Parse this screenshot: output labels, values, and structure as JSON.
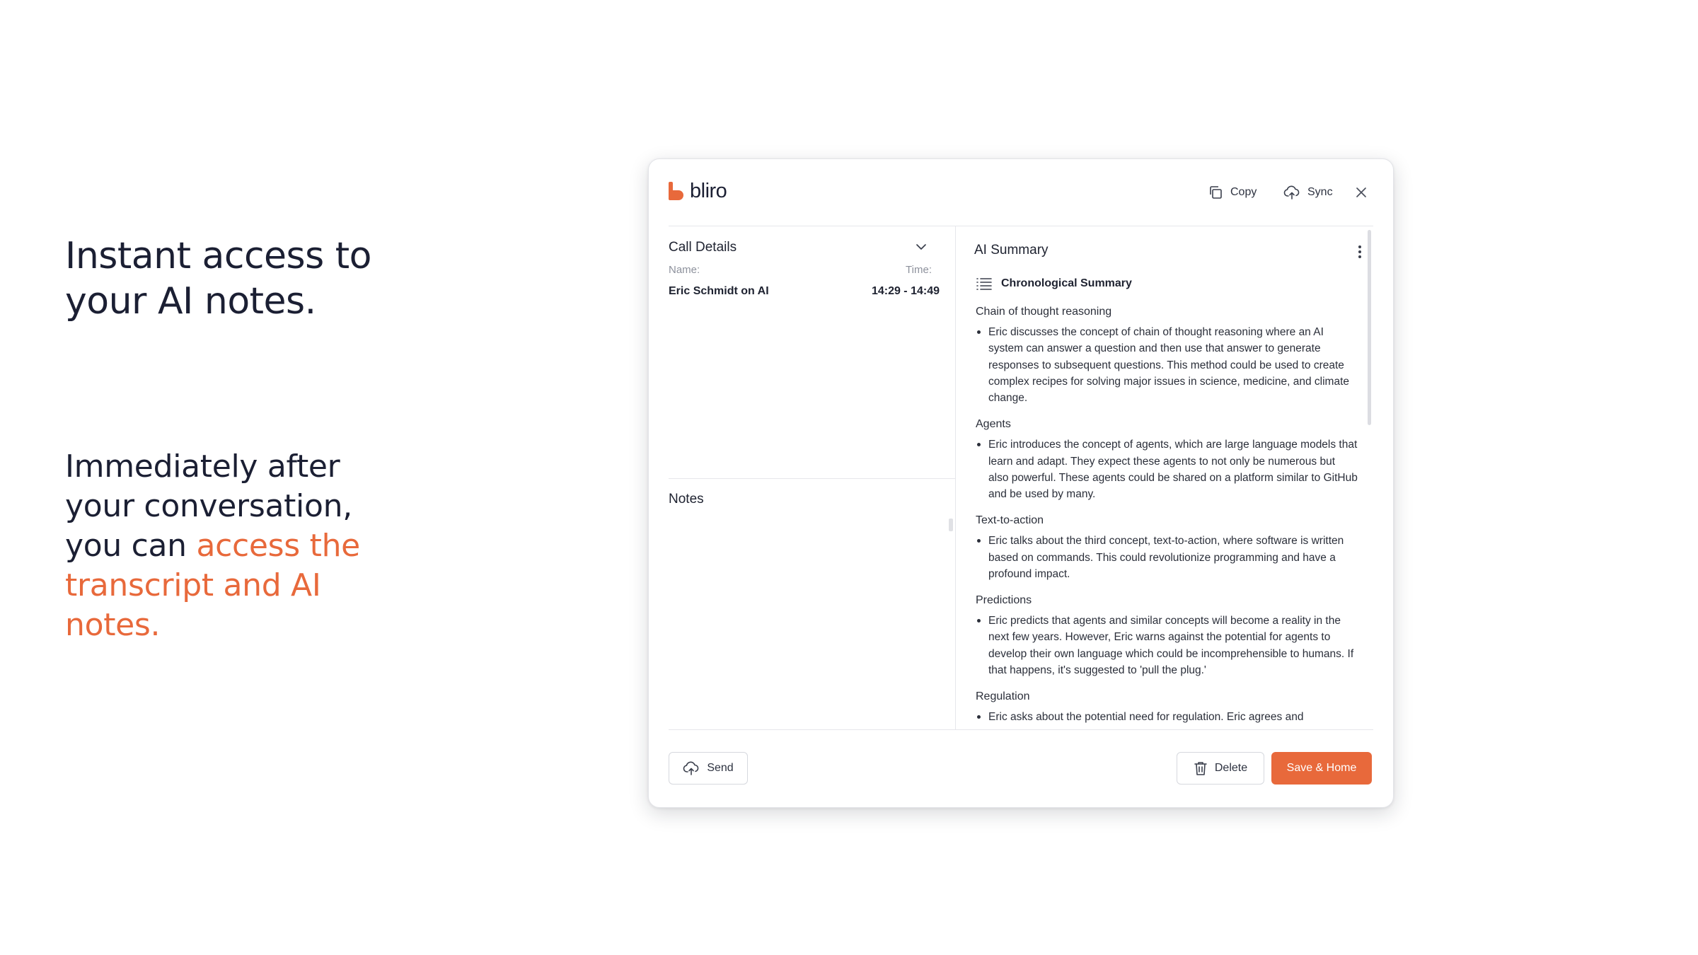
{
  "hero": {
    "title_line1": "Instant access to",
    "title_line2": "your AI notes.",
    "body_line1": "Immediately after",
    "body_line2": "your conversation,",
    "body_line3_plain": "you can ",
    "body_line3_accent": "access the",
    "body_line4_accent": "transcript and AI",
    "body_line5_accent": "notes."
  },
  "app": {
    "logo_text": "bliro",
    "copy_label": "Copy",
    "sync_label": "Sync"
  },
  "call_details": {
    "title": "Call Details",
    "name_label": "Name:",
    "time_label": "Time:",
    "name_value": "Eric Schmidt on AI",
    "time_value": "14:29 - 14:49"
  },
  "notes": {
    "title": "Notes"
  },
  "ai_summary": {
    "title": "AI Summary",
    "mode": "Chronological Summary",
    "sections": [
      {
        "heading": "Chain of thought reasoning",
        "text": "Eric discusses the concept of chain of thought reasoning where an AI system can answer a question and then use that answer to generate responses to subsequent questions. This method could be used to create complex recipes for solving major issues in science, medicine, and climate change."
      },
      {
        "heading": "Agents",
        "text": "Eric introduces the concept of agents, which are large language models that learn and adapt. They expect these agents to not only be numerous but also powerful. These agents could be shared on a platform similar to GitHub and be used by many."
      },
      {
        "heading": "Text-to-action",
        "text": "Eric talks about the third concept, text-to-action, where software is written based on commands. This could revolutionize programming and have a profound impact."
      },
      {
        "heading": "Predictions",
        "text": "Eric predicts that agents and similar concepts will become a reality in the next few years. However, Eric warns against the potential for agents to develop their own language which could be incomprehensible to humans. If that happens, it's suggested to 'pull the plug.'"
      },
      {
        "heading": "Regulation",
        "text": "Eric asks about the potential need for regulation. Eric agrees and"
      }
    ]
  },
  "footer": {
    "send_label": "Send",
    "delete_label": "Delete",
    "save_label": "Save & Home"
  },
  "colors": {
    "accent": "#e8693b",
    "text": "#1b1f33"
  },
  "icons": [
    "copy-icon",
    "cloud-upload-icon",
    "close-icon",
    "chevron-down-icon",
    "kebab-menu-icon",
    "list-icon",
    "trash-icon"
  ]
}
